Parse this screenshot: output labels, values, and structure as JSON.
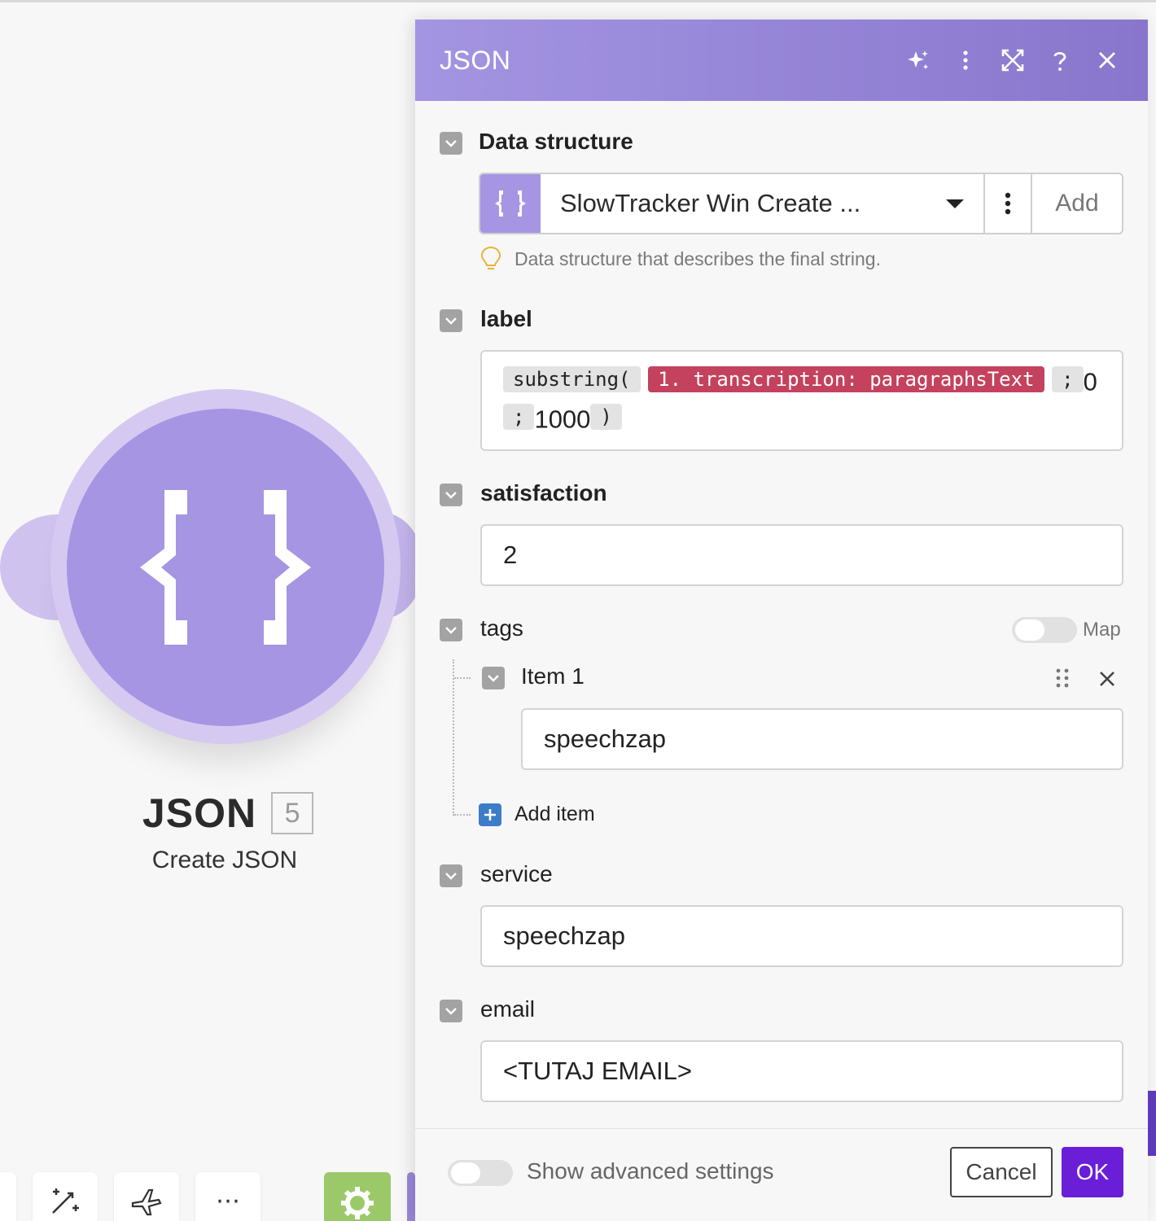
{
  "module": {
    "name": "JSON",
    "number": "5",
    "subtitle": "Create JSON"
  },
  "panel": {
    "title": "JSON",
    "icons": [
      "sparkle-icon",
      "kebab-menu-icon",
      "expand-icon",
      "help-icon",
      "close-icon"
    ]
  },
  "data_structure": {
    "label": "Data structure",
    "selected": "SlowTracker Win Create ...",
    "add_label": "Add",
    "hint": "Data structure that describes the final string."
  },
  "label_field": {
    "label": "label",
    "fn": "substring(",
    "mapped": "1. transcription: paragraphsText",
    "sep1": ";",
    "arg1": "0",
    "sep2": ";",
    "arg2": "1000",
    "close": ")"
  },
  "satisfaction": {
    "label": "satisfaction",
    "value": "2"
  },
  "tags": {
    "label": "tags",
    "map_label": "Map",
    "item_label": "Item 1",
    "item_value": "speechzap",
    "add_item": "Add item"
  },
  "service": {
    "label": "service",
    "value": "speechzap"
  },
  "email": {
    "label": "email",
    "value": "<TUTAJ EMAIL>"
  },
  "footer": {
    "advanced_label": "Show advanced settings",
    "cancel": "Cancel",
    "ok": "OK"
  },
  "colors": {
    "accent": "#a595e3",
    "header_start": "#a495e2",
    "header_end": "#8876cc",
    "ok_button": "#6a1ed8",
    "mapped_pill": "#c4425e"
  }
}
